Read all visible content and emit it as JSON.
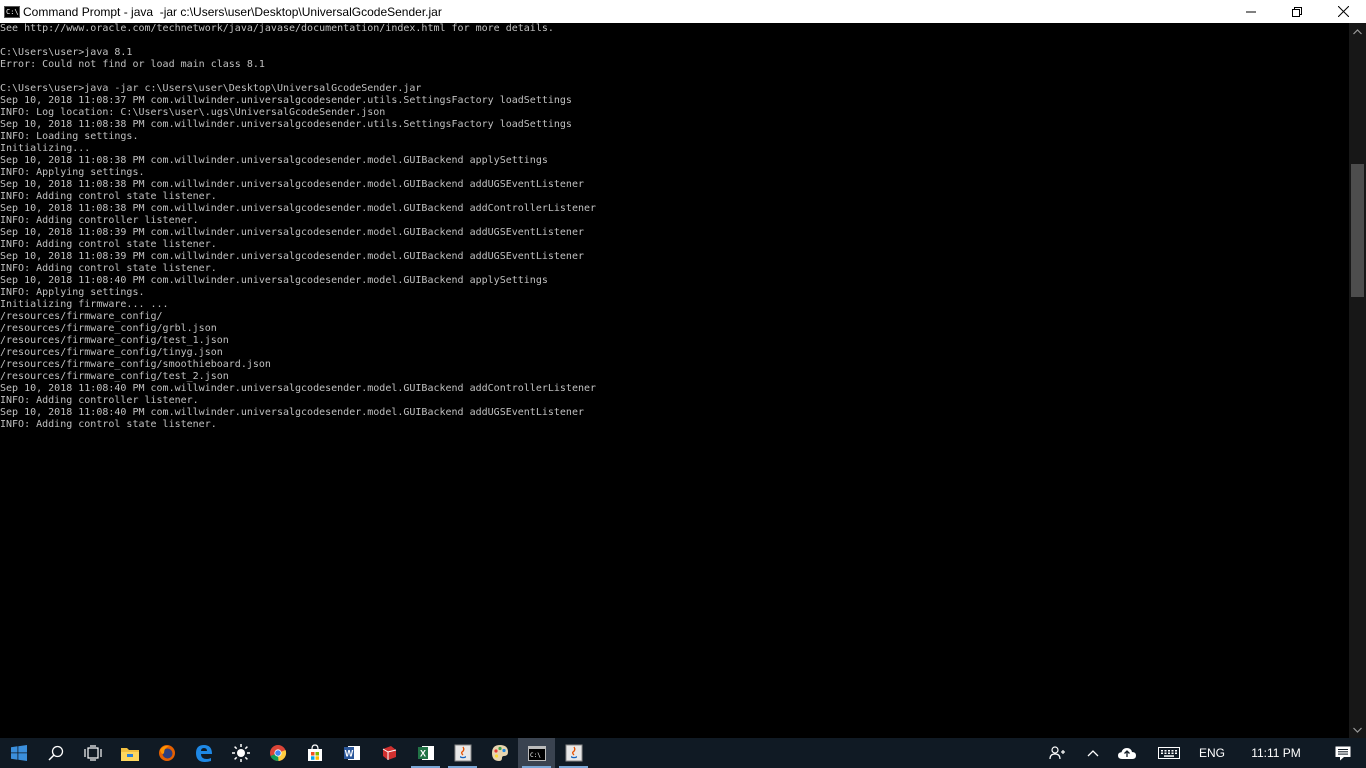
{
  "window": {
    "title": "Command Prompt - java  -jar c:\\Users\\user\\Desktop\\UniversalGcodeSender.jar",
    "icon": "cmd-icon",
    "controls": [
      "minimize-icon",
      "restore-icon",
      "close-icon"
    ]
  },
  "console": {
    "lines": [
      "See http://www.oracle.com/technetwork/java/javase/documentation/index.html for more details.",
      "",
      "C:\\Users\\user>java 8.1",
      "Error: Could not find or load main class 8.1",
      "",
      "C:\\Users\\user>java -jar c:\\Users\\user\\Desktop\\UniversalGcodeSender.jar",
      "Sep 10, 2018 11:08:37 PM com.willwinder.universalgcodesender.utils.SettingsFactory loadSettings",
      "INFO: Log location: C:\\Users\\user\\.ugs\\UniversalGcodeSender.json",
      "Sep 10, 2018 11:08:38 PM com.willwinder.universalgcodesender.utils.SettingsFactory loadSettings",
      "INFO: Loading settings.",
      "Initializing...",
      "Sep 10, 2018 11:08:38 PM com.willwinder.universalgcodesender.model.GUIBackend applySettings",
      "INFO: Applying settings.",
      "Sep 10, 2018 11:08:38 PM com.willwinder.universalgcodesender.model.GUIBackend addUGSEventListener",
      "INFO: Adding control state listener.",
      "Sep 10, 2018 11:08:38 PM com.willwinder.universalgcodesender.model.GUIBackend addControllerListener",
      "INFO: Adding controller listener.",
      "Sep 10, 2018 11:08:39 PM com.willwinder.universalgcodesender.model.GUIBackend addUGSEventListener",
      "INFO: Adding control state listener.",
      "Sep 10, 2018 11:08:39 PM com.willwinder.universalgcodesender.model.GUIBackend addUGSEventListener",
      "INFO: Adding control state listener.",
      "Sep 10, 2018 11:08:40 PM com.willwinder.universalgcodesender.model.GUIBackend applySettings",
      "INFO: Applying settings.",
      "Initializing firmware... ...",
      "/resources/firmware_config/",
      "/resources/firmware_config/grbl.json",
      "/resources/firmware_config/test_1.json",
      "/resources/firmware_config/tinyg.json",
      "/resources/firmware_config/smoothieboard.json",
      "/resources/firmware_config/test_2.json",
      "Sep 10, 2018 11:08:40 PM com.willwinder.universalgcodesender.model.GUIBackend addControllerListener",
      "INFO: Adding controller listener.",
      "Sep 10, 2018 11:08:40 PM com.willwinder.universalgcodesender.model.GUIBackend addUGSEventListener",
      "INFO: Adding control state listener."
    ],
    "text_color": "#c0c0c0",
    "background": "#000000"
  },
  "taskbar": {
    "items": [
      {
        "name": "start-button",
        "icon": "windows-logo-icon",
        "open": false,
        "active": false
      },
      {
        "name": "search-button",
        "icon": "search-icon",
        "open": false,
        "active": false
      },
      {
        "name": "task-view-button",
        "icon": "task-view-icon",
        "open": false,
        "active": false
      },
      {
        "name": "file-explorer-button",
        "icon": "folder-icon",
        "open": false,
        "active": false
      },
      {
        "name": "firefox-button",
        "icon": "firefox-icon",
        "open": false,
        "active": false
      },
      {
        "name": "edge-button",
        "icon": "edge-icon",
        "open": false,
        "active": false
      },
      {
        "name": "sun-app-button",
        "icon": "sun-icon",
        "open": false,
        "active": false
      },
      {
        "name": "chrome-button",
        "icon": "chrome-icon",
        "open": false,
        "active": false
      },
      {
        "name": "store-button",
        "icon": "store-icon",
        "open": false,
        "active": false
      },
      {
        "name": "word-button",
        "icon": "word-icon",
        "open": false,
        "active": false
      },
      {
        "name": "sketchup-button",
        "icon": "sketchup-icon",
        "open": false,
        "active": false
      },
      {
        "name": "excel-button",
        "icon": "excel-icon",
        "open": true,
        "active": false
      },
      {
        "name": "java-app-button",
        "icon": "java-icon",
        "open": true,
        "active": false
      },
      {
        "name": "paint-button",
        "icon": "paint-icon",
        "open": false,
        "active": false
      },
      {
        "name": "command-prompt-button",
        "icon": "cmd-icon",
        "open": true,
        "active": true
      },
      {
        "name": "java-app-2-button",
        "icon": "java-icon",
        "open": true,
        "active": false
      }
    ],
    "tray": {
      "language": "ENG",
      "time": "11:11 PM",
      "icons": [
        "people-icon",
        "chevron-up-icon",
        "onedrive-icon",
        "keyboard-icon",
        "notification-icon"
      ]
    },
    "accent": "#7aa7d6"
  }
}
